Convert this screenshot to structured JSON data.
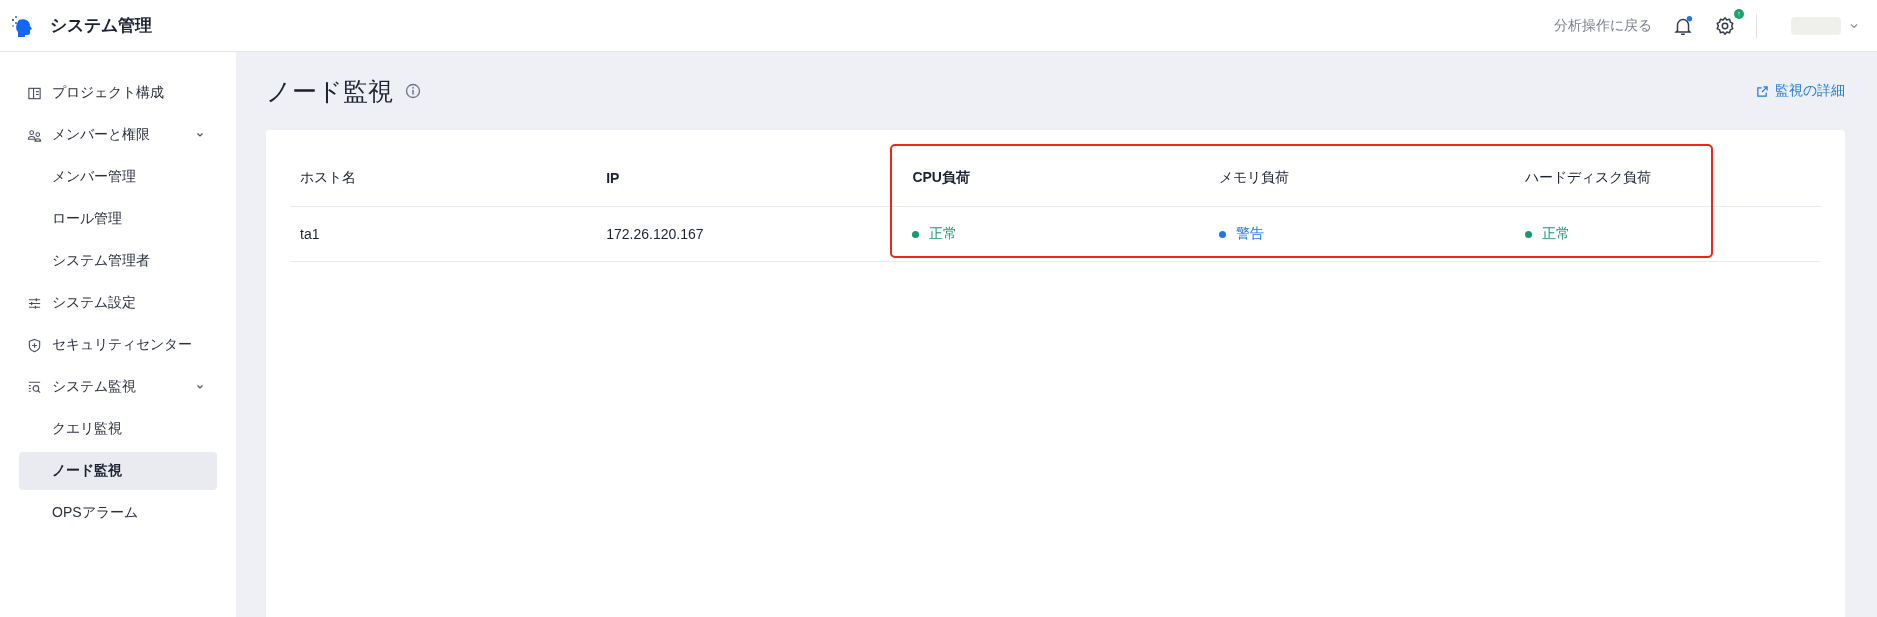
{
  "header": {
    "title": "システム管理",
    "back_link": "分析操作に戻る",
    "notification_dot": true,
    "settings_badge": "↑"
  },
  "sidebar": {
    "items": [
      {
        "label": "プロジェクト構成",
        "kind": "layout",
        "selected": false
      },
      {
        "label": "メンバーと権限",
        "kind": "users",
        "expanded": true,
        "selected": false,
        "children": [
          {
            "label": "メンバー管理",
            "selected": false
          },
          {
            "label": "ロール管理",
            "selected": false
          },
          {
            "label": "システム管理者",
            "selected": false
          }
        ]
      },
      {
        "label": "システム設定",
        "kind": "sliders",
        "selected": false
      },
      {
        "label": "セキュリティセンター",
        "kind": "shield",
        "selected": false
      },
      {
        "label": "システム監視",
        "kind": "monitor",
        "expanded": true,
        "selected": false,
        "children": [
          {
            "label": "クエリ監視",
            "selected": false
          },
          {
            "label": "ノード監視",
            "selected": true
          },
          {
            "label": "OPSアラーム",
            "selected": false
          }
        ]
      }
    ]
  },
  "page": {
    "title": "ノード監視",
    "details_link": "監視の詳細"
  },
  "table": {
    "columns": [
      {
        "label": "ホスト名",
        "bold": false
      },
      {
        "label": "IP",
        "bold": true
      },
      {
        "label": "CPU負荷",
        "bold": true
      },
      {
        "label": "メモリ負荷",
        "bold": false
      },
      {
        "label": "ハードディスク負荷",
        "bold": false
      }
    ],
    "rows": [
      {
        "host": "ta1",
        "ip": "172.26.120.167",
        "statuses": [
          {
            "label": "正常",
            "color": "#1a9a6c"
          },
          {
            "label": "警告",
            "color": "#1f7ae0"
          },
          {
            "label": "正常",
            "color": "#1a9a6c"
          }
        ]
      }
    ]
  }
}
